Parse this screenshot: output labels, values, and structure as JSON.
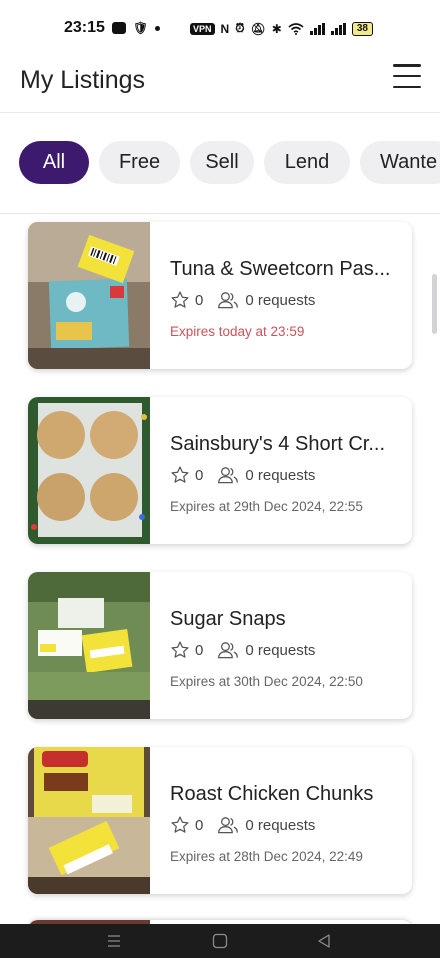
{
  "status_bar": {
    "time": "23:15",
    "vpn": "VPN",
    "nfc": "N",
    "battery": "38",
    "icons": [
      "media-icon",
      "shield-icon",
      "dot-icon",
      "vpn-icon",
      "nfc-icon",
      "alarm-icon",
      "mute-icon",
      "bluetooth-icon",
      "wifi-icon",
      "signal-icon",
      "signal-icon",
      "battery-icon"
    ]
  },
  "header": {
    "title": "My Listings",
    "menu_icon": "hamburger-menu-icon"
  },
  "filters": [
    {
      "label": "All",
      "active": true
    },
    {
      "label": "Free",
      "active": false
    },
    {
      "label": "Sell",
      "active": false
    },
    {
      "label": "Lend",
      "active": false
    },
    {
      "label": "Wante",
      "active": false
    }
  ],
  "listings": [
    {
      "title": "Tuna & Sweetcorn Pas...",
      "likes": "0",
      "requests": "0 requests",
      "expiry": "Expires today at  23:59",
      "urgent": true
    },
    {
      "title": "Sainsbury's 4 Short Cr...",
      "likes": "0",
      "requests": "0 requests",
      "expiry": "Expires at  29th Dec 2024, 22:55",
      "urgent": false
    },
    {
      "title": "Sugar Snaps",
      "likes": "0",
      "requests": "0 requests",
      "expiry": "Expires at  30th Dec 2024, 22:50",
      "urgent": false
    },
    {
      "title": "Roast Chicken Chunks",
      "likes": "0",
      "requests": "0 requests",
      "expiry": "Expires at  28th Dec 2024, 22:49",
      "urgent": false
    }
  ],
  "colors": {
    "accent": "#3e1a6e",
    "urgent_text": "#c9535a",
    "chip_bg": "#efeff1"
  },
  "nav_bar": {
    "icons": [
      "recents-icon",
      "home-icon",
      "back-icon"
    ]
  }
}
